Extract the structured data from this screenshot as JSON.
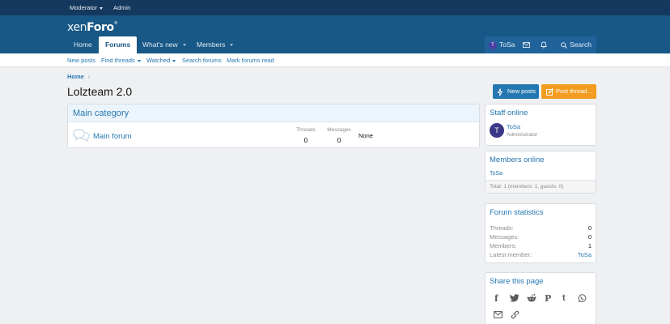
{
  "staffbar": {
    "moderator": "Moderator",
    "admin": "Admin"
  },
  "logo": {
    "part1": "xen",
    "part2": "Foro",
    "mark": "®"
  },
  "nav": {
    "tabs": [
      {
        "label": "Home"
      },
      {
        "label": "Forums"
      },
      {
        "label": "What's new"
      },
      {
        "label": "Members"
      }
    ],
    "user": "ToSa",
    "avatar_letter": "T",
    "search": "Search"
  },
  "subnav": {
    "items": [
      "New posts",
      "Find threads",
      "Watched",
      "Search forums",
      "Mark forums read"
    ]
  },
  "breadcrumb": {
    "home": "Home",
    "sep": "›"
  },
  "page": {
    "title": "Lolzteam 2.0"
  },
  "buttons": {
    "new_posts": "New posts",
    "post_thread": "Post thread…"
  },
  "category": {
    "title": "Main category",
    "forum": {
      "title": "Main forum",
      "threads_label": "Threads",
      "threads": "0",
      "messages_label": "Messages",
      "messages": "0",
      "latest": "None"
    }
  },
  "staff_online": {
    "title": "Staff online",
    "member": {
      "name": "ToSa",
      "role": "Administrator",
      "avatar_letter": "T"
    }
  },
  "members_online": {
    "title": "Members online",
    "member": "ToSa",
    "total": "Total: 1 (members: 1, guests: 0)"
  },
  "forum_statistics": {
    "title": "Forum statistics",
    "rows": [
      {
        "label": "Threads:",
        "value": "0"
      },
      {
        "label": "Messages:",
        "value": "0"
      },
      {
        "label": "Members:",
        "value": "1"
      },
      {
        "label": "Latest member:",
        "value": "ToSa"
      }
    ]
  },
  "share": {
    "title": "Share this page",
    "icons": [
      "facebook-icon",
      "twitter-icon",
      "reddit-icon",
      "pinterest-icon",
      "tumblr-icon",
      "whatsapp-icon",
      "email-icon",
      "link-icon"
    ]
  },
  "colors": {
    "staffbar": "#15395e",
    "header": "#185886",
    "accent_link": "#2577b1",
    "btn_new_posts": "#2577b1",
    "btn_post_thread": "#f39c1f"
  }
}
